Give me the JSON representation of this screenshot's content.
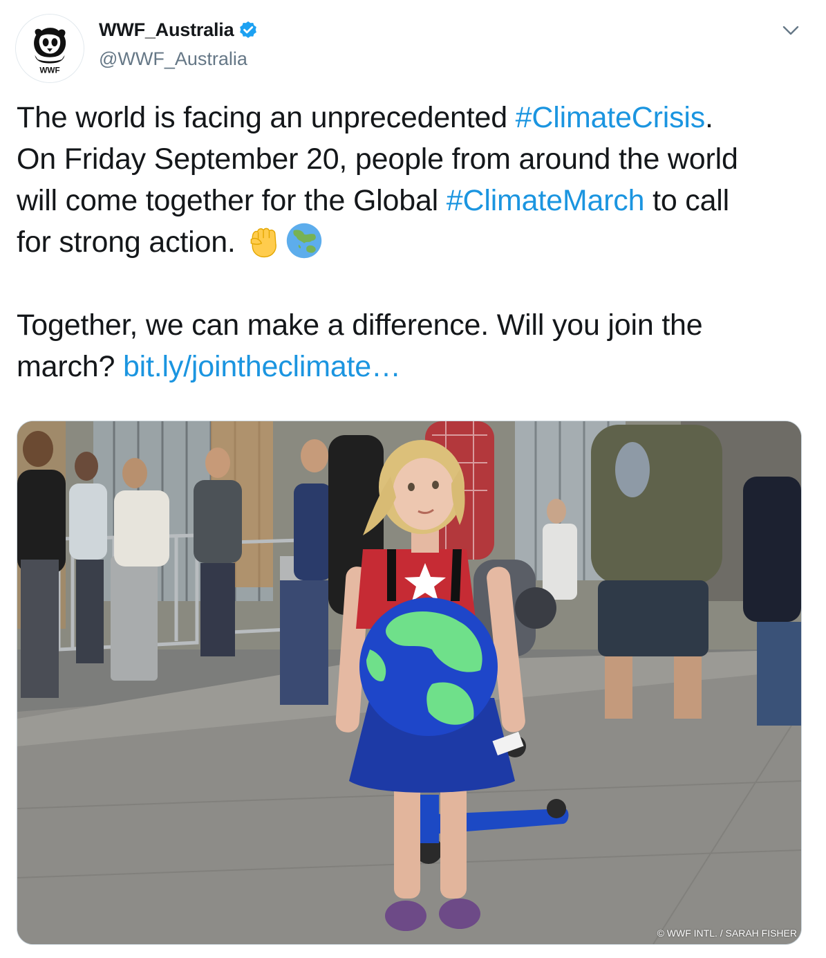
{
  "author": {
    "display_name": "WWF_Australia",
    "handle": "@WWF_Australia",
    "verified": true,
    "avatar_logo_text": "WWF"
  },
  "tweet": {
    "line1_pre": "The world is facing an unprecedented ",
    "hashtag_1": "#ClimateCrisis",
    "line1_post": ".",
    "line2": "On Friday September 20, people from around the world",
    "line3_pre": "will come together for the Global ",
    "hashtag_2": "#ClimateMarch",
    "line3_post": " to call",
    "line4": "for strong action. ",
    "line5": "Together, we can make a difference. Will you join the",
    "line6_pre": "march? ",
    "link": "bit.ly/jointheclimate…",
    "emojis": [
      "raised-fist-icon",
      "globe-asia-australia-icon"
    ]
  },
  "media": {
    "photo_credit": "© WWF INTL. / SARAH FISHER"
  },
  "colors": {
    "link": "#1b95e0",
    "text": "#14171a",
    "secondary": "#657786",
    "verified": "#1da1f2"
  }
}
